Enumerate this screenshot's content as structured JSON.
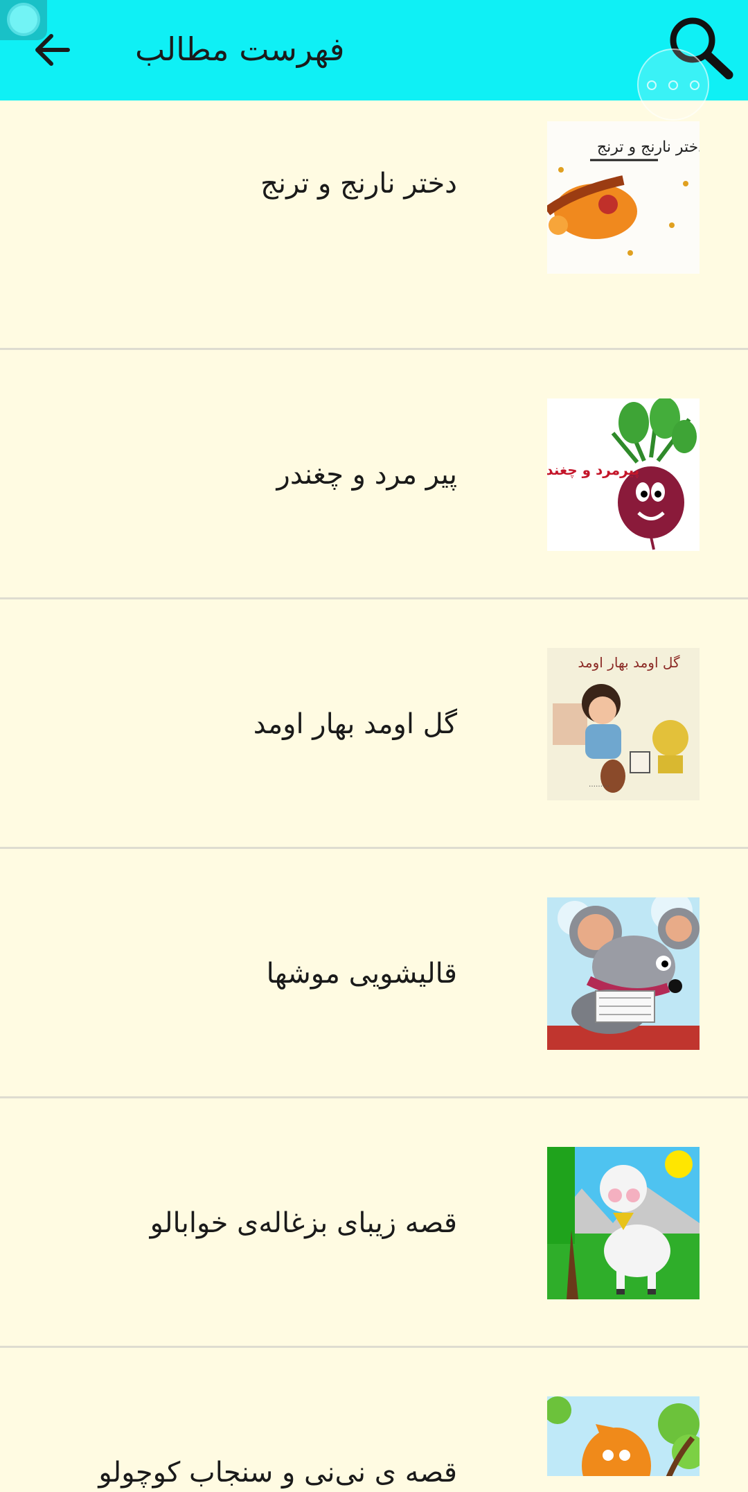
{
  "appbar": {
    "title": "فهرست مطالب",
    "back_icon": "arrow-left-icon",
    "search_icon": "search-icon",
    "bg_color": "#0ff0f5"
  },
  "stories": [
    {
      "title": "دختر نارنج و ترنج",
      "cover_text": "دختر نارنج و ترنج"
    },
    {
      "title": "پیر مرد و چغندر",
      "cover_text": "پیرمرد و چغندر"
    },
    {
      "title": "گل اومد بهار اومد",
      "cover_text": "گل اومد بهار اومد"
    },
    {
      "title": "قالیشویی موشها"
    },
    {
      "title": "قصه زیبای بزغاله‌ی خوابالو"
    },
    {
      "title": "قصه ی نی‌نی و سنجاب کوچولو"
    }
  ]
}
